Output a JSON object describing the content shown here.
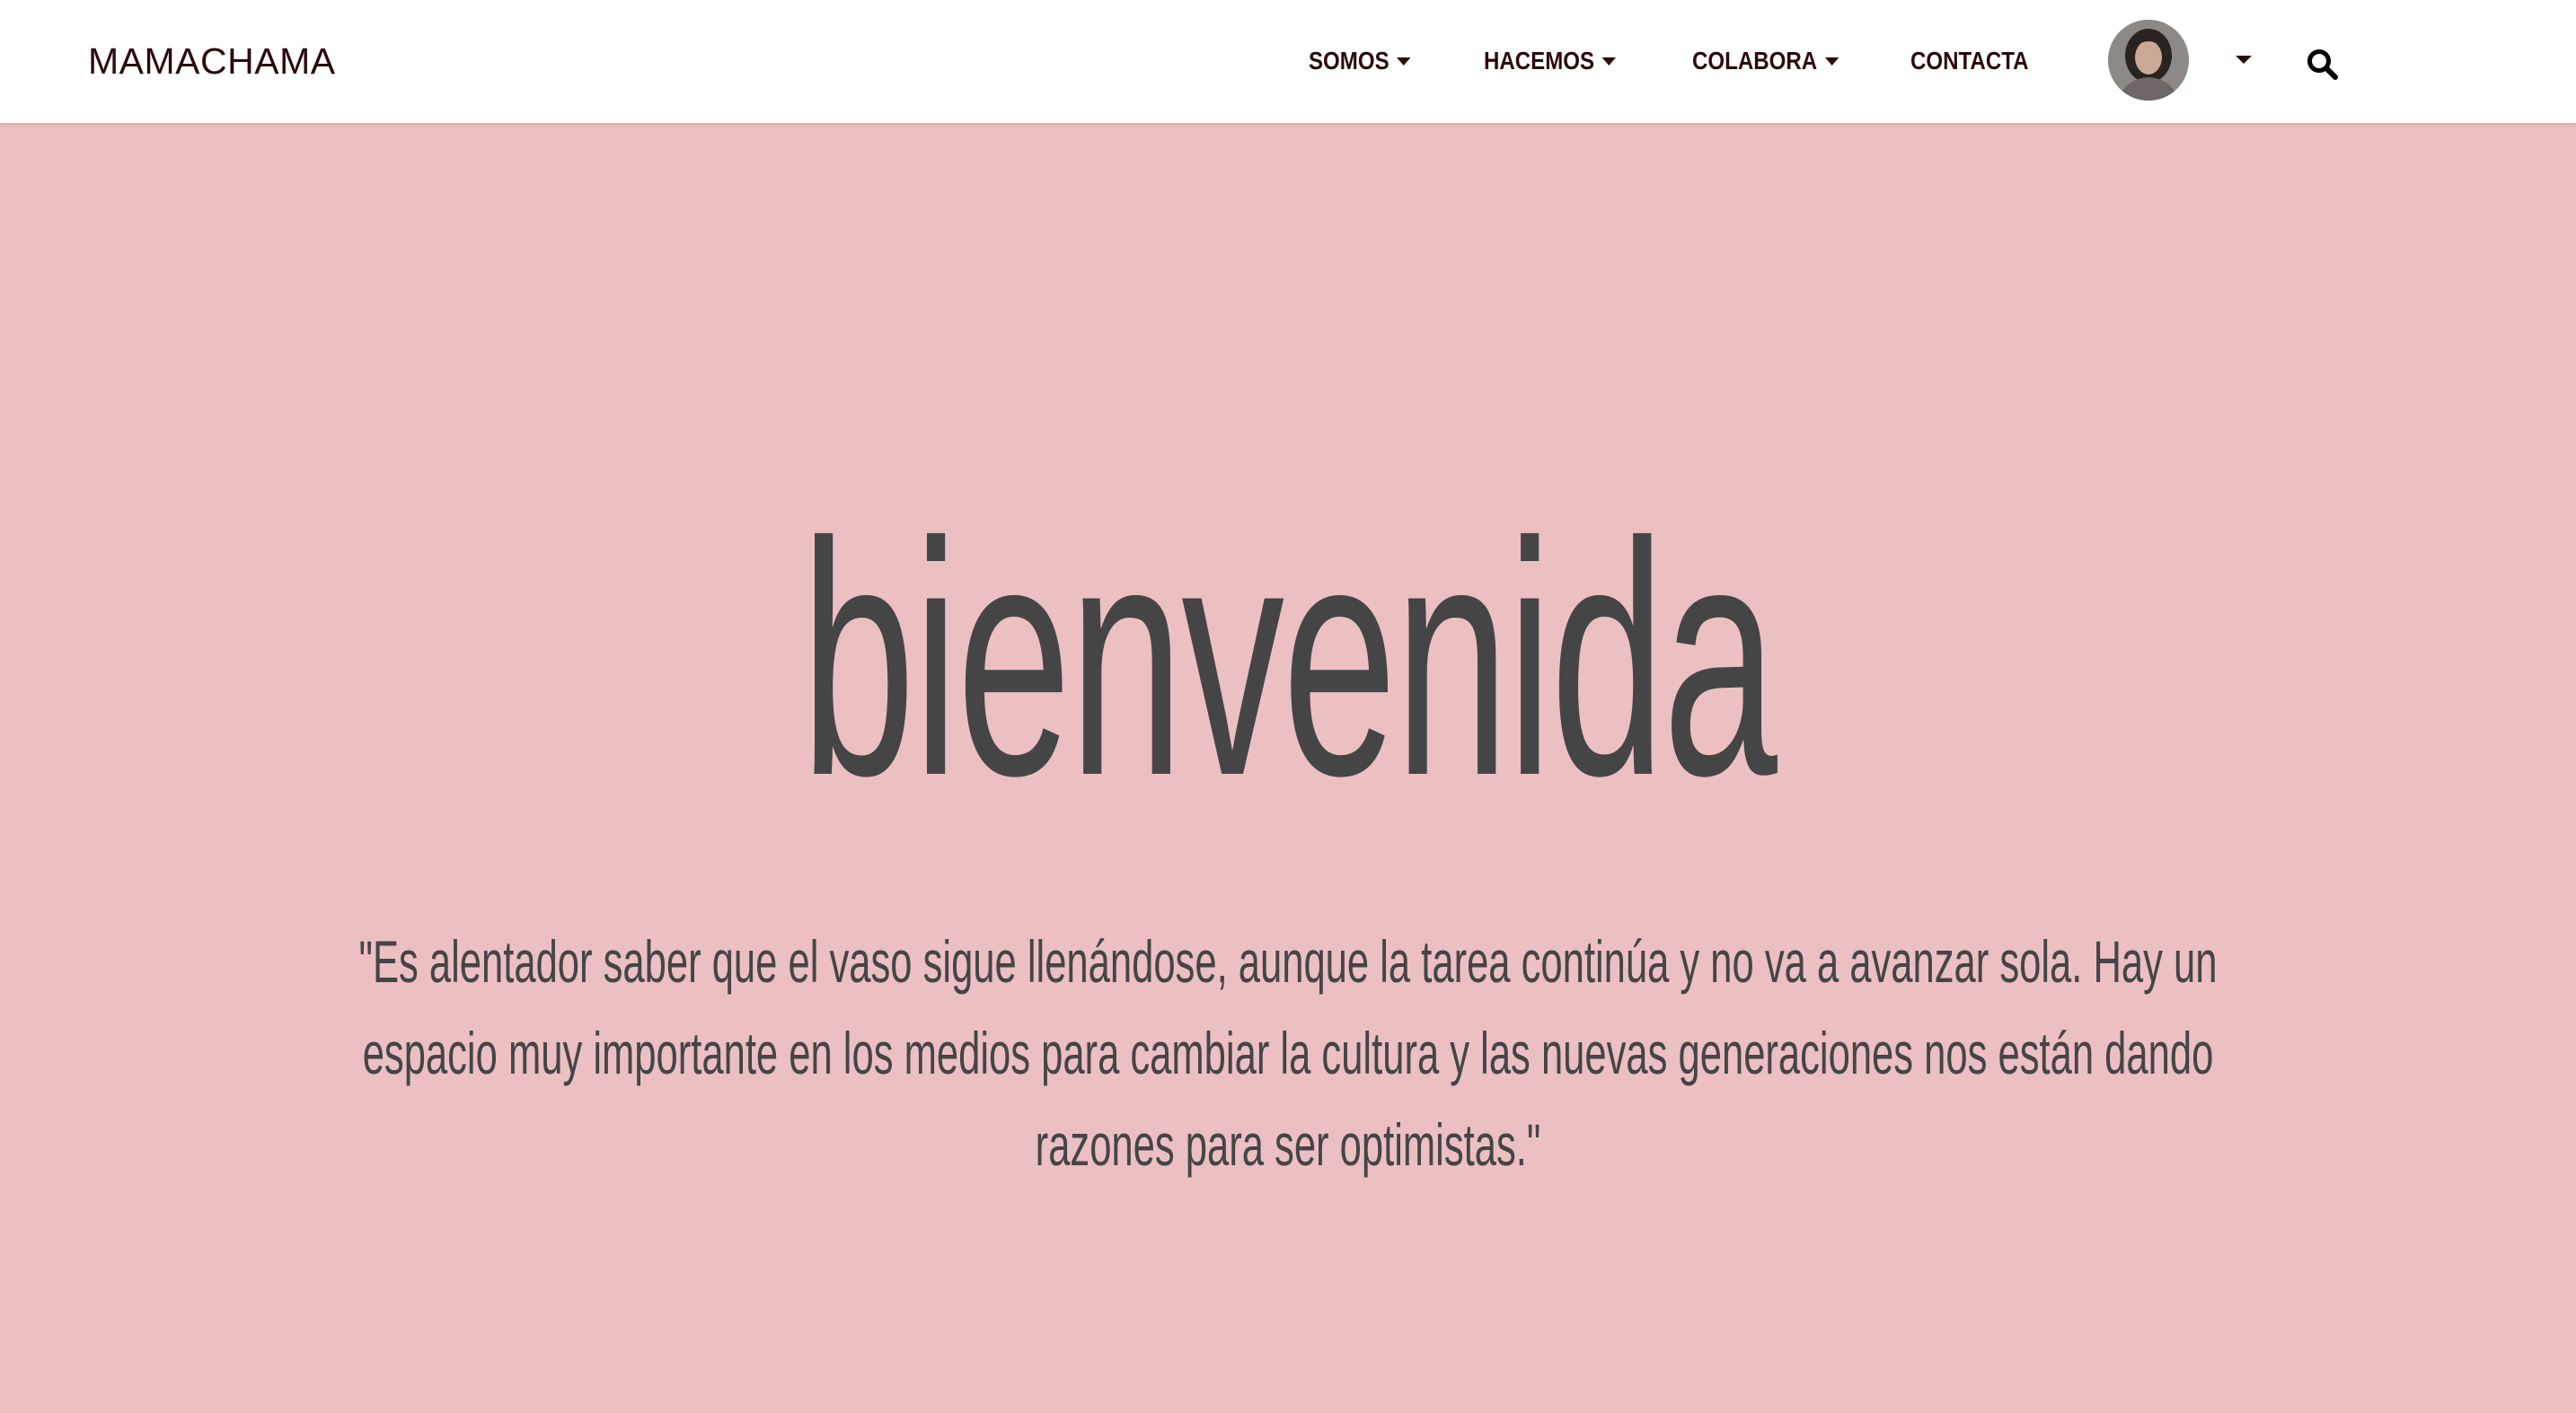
{
  "navbar": {
    "brand": "MAMACHAMA",
    "items": [
      {
        "label": "SOMOS",
        "has_dropdown": true
      },
      {
        "label": "HACEMOS",
        "has_dropdown": true
      },
      {
        "label": "COLABORA",
        "has_dropdown": true
      },
      {
        "label": "CONTACTA",
        "has_dropdown": false
      }
    ],
    "user_menu_icon": "avatar",
    "user_menu_caret_icon": "caret-down-icon",
    "search_icon": "search-icon"
  },
  "hero": {
    "title": "bienvenida",
    "quote": "\"Es alentador saber que el vaso sigue llenándose, aunque la tarea continúa y no va a avanzar sola. Hay un espacio muy importante en los medios para cambiar la cultura y las nuevas generaciones nos están dando razones para ser optimistas.\""
  },
  "colors": {
    "navbar_bg": "#ffffff",
    "nav_text": "#2b0a0e",
    "hero_bg": "#ECBFC3",
    "hero_text": "#454545"
  }
}
